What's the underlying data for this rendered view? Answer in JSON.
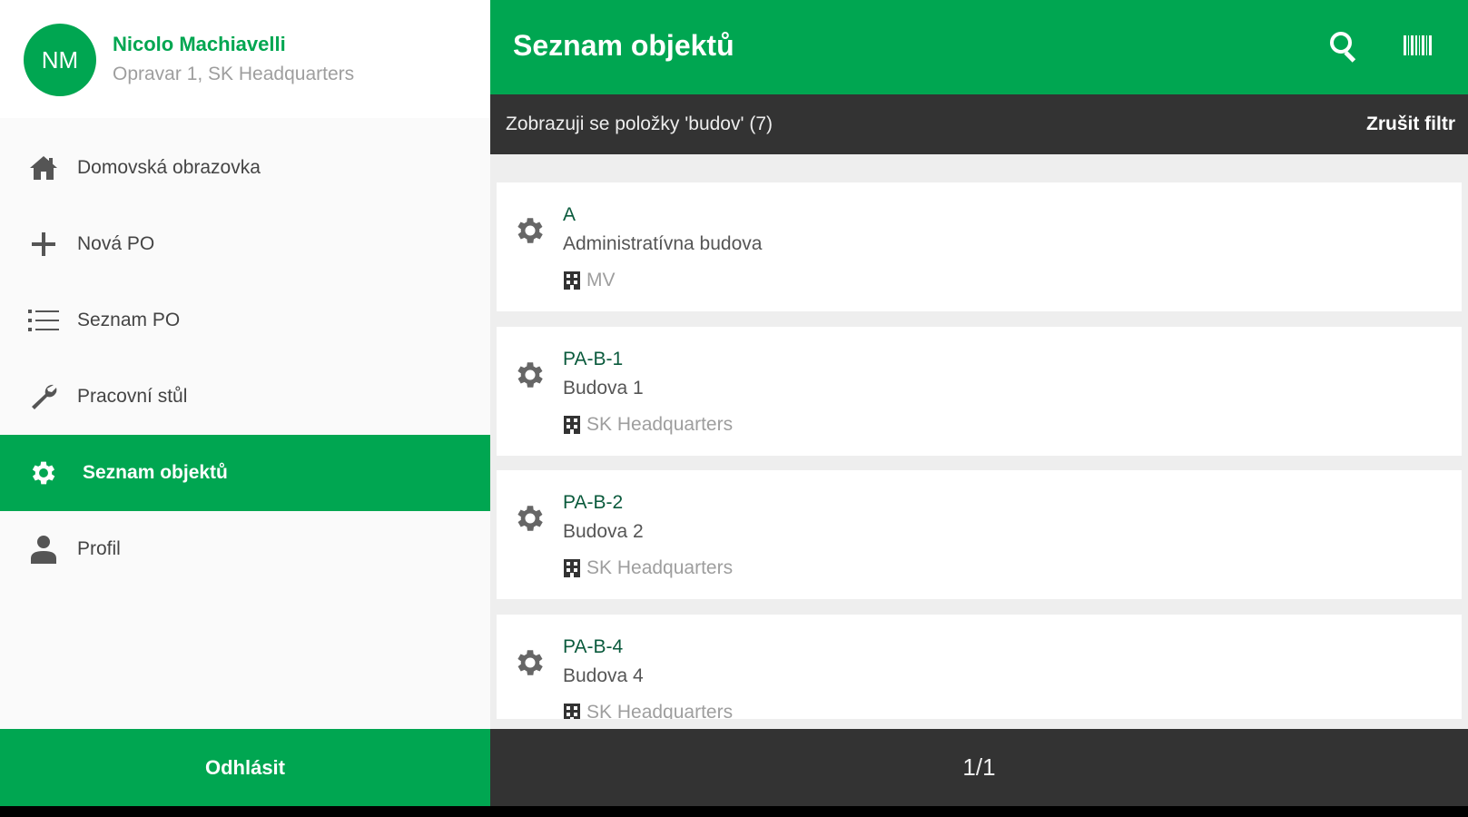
{
  "user": {
    "initials": "NM",
    "name": "Nicolo Machiavelli",
    "role": "Opravar 1, SK Headquarters"
  },
  "nav": {
    "items": [
      {
        "label": "Domovská obrazovka",
        "icon": "home-icon"
      },
      {
        "label": "Nová PO",
        "icon": "plus-icon"
      },
      {
        "label": "Seznam PO",
        "icon": "list-icon"
      },
      {
        "label": "Pracovní stůl",
        "icon": "wrench-icon"
      },
      {
        "label": "Seznam objektů",
        "icon": "gear-icon",
        "active": true
      },
      {
        "label": "Profil",
        "icon": "person-icon"
      }
    ],
    "logout_label": "Odhlásit"
  },
  "appbar": {
    "title": "Seznam objektů",
    "search_icon": "search-icon",
    "barcode_icon": "barcode-icon"
  },
  "filter": {
    "text": "Zobrazuji se položky 'budov' (7)",
    "clear_label": "Zrušit filtr"
  },
  "objects": [
    {
      "code": "A",
      "description": "Administratívna budova",
      "site": "MV"
    },
    {
      "code": "PA-B-1",
      "description": "Budova 1",
      "site": "SK Headquarters"
    },
    {
      "code": "PA-B-2",
      "description": "Budova 2",
      "site": "SK Headquarters"
    },
    {
      "code": "PA-B-4",
      "description": "Budova 4",
      "site": "SK Headquarters"
    }
  ],
  "pagination": {
    "text": "1/1"
  },
  "colors": {
    "accent": "#00a651",
    "dark": "#333333"
  }
}
